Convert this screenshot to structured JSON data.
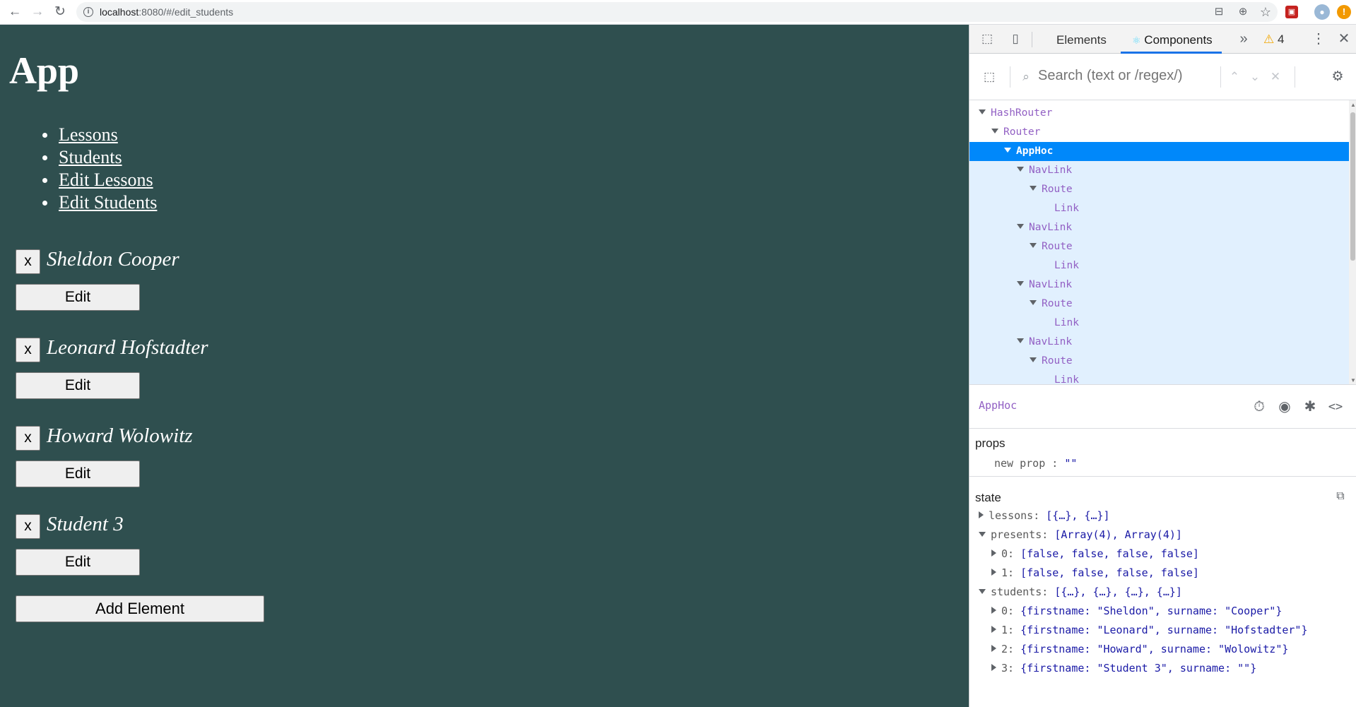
{
  "browser": {
    "url_host": "localhost",
    "url_rest": ":8080/#/edit_students"
  },
  "app": {
    "title": "App",
    "nav": [
      "Lessons",
      "Students",
      "Edit Lessons",
      "Edit Students"
    ],
    "remove_label": "x",
    "edit_label": "Edit",
    "students": [
      "Sheldon Cooper",
      "Leonard Hofstadter",
      "Howard Wolowitz",
      "Student 3"
    ],
    "add_label": "Add Element"
  },
  "devtools": {
    "tabs": [
      "Elements",
      "Components"
    ],
    "active_tab": "Components",
    "warnings_count": "4",
    "search_placeholder": "Search (text or /regex/)",
    "tree": [
      {
        "name": "HashRouter",
        "depth": 0
      },
      {
        "name": "Router",
        "depth": 1
      },
      {
        "name": "AppHoc",
        "depth": 2
      },
      {
        "name": "NavLink",
        "depth": 3
      },
      {
        "name": "Route",
        "depth": 4
      },
      {
        "name": "Link",
        "depth": 5
      },
      {
        "name": "NavLink",
        "depth": 3
      },
      {
        "name": "Route",
        "depth": 4
      },
      {
        "name": "Link",
        "depth": 5
      },
      {
        "name": "NavLink",
        "depth": 3
      },
      {
        "name": "Route",
        "depth": 4
      },
      {
        "name": "Link",
        "depth": 5
      },
      {
        "name": "NavLink",
        "depth": 3
      },
      {
        "name": "Route",
        "depth": 4
      },
      {
        "name": "Link",
        "depth": 5
      }
    ],
    "selected_component": "AppHoc",
    "props_title": "props",
    "props_new_key": "new prop",
    "props_new_value": "\"\"",
    "state_title": "state",
    "state": {
      "lessons_key": "lessons",
      "lessons_val": "[{…}, {…}]",
      "presents_key": "presents",
      "presents_val": "[Array(4), Array(4)]",
      "presents_items": [
        "[false, false, false, false]",
        "[false, false, false, false]"
      ],
      "students_key": "students",
      "students_val": "[{…}, {…}, {…}, {…}]",
      "students_items": [
        "{firstname: \"Sheldon\", surname: \"Cooper\"}",
        "{firstname: \"Leonard\", surname: \"Hofstadter\"}",
        "{firstname: \"Howard\", surname: \"Wolowitz\"}",
        "{firstname: \"Student 3\", surname: \"\"}"
      ]
    }
  }
}
